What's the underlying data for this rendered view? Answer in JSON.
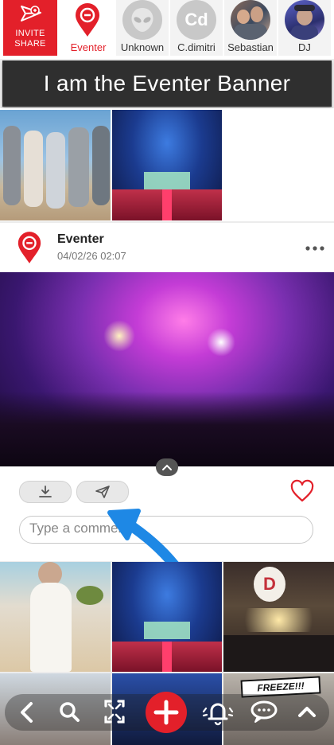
{
  "stories": {
    "invite_label_line1": "INVITE",
    "invite_label_line2": "SHARE",
    "items": [
      {
        "label": "Eventer",
        "avatar": "eventer-logo-icon",
        "active": true
      },
      {
        "label": "Unknown",
        "avatar": "alien-icon"
      },
      {
        "label": "C.dimitri",
        "initials": "Cd"
      },
      {
        "label": "Sebastian",
        "avatar": "photo"
      },
      {
        "label": "DJ",
        "avatar": "photo"
      }
    ]
  },
  "banner": {
    "text": "I am the Eventer Banner"
  },
  "post": {
    "author": "Eventer",
    "date": "04/02/26 02:07",
    "comment_placeholder": "Type a comment"
  },
  "overlay": {
    "freeze_label": "FREEZE!!!",
    "balloon_letter": "D"
  },
  "colors": {
    "brand_red": "#e3202a",
    "banner_bg": "#2f2f2f",
    "arrow_blue": "#1e88e5"
  },
  "bottom_nav": [
    "back-icon",
    "search-icon",
    "fullscreen-icon",
    "add-icon",
    "notification-bell-icon",
    "chat-icon",
    "collapse-up-icon"
  ]
}
